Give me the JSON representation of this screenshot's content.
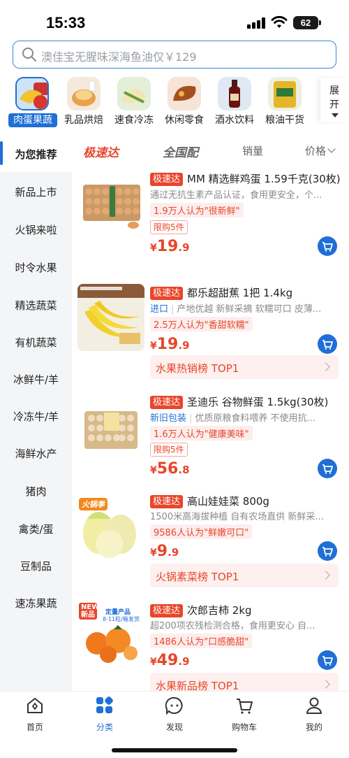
{
  "status": {
    "time": "15:33",
    "battery": "62"
  },
  "search": {
    "placeholder": "澳佳宝无腥味深海鱼油仅￥129"
  },
  "categories": [
    {
      "label": "肉蛋果蔬",
      "icon": "produce-meat-icon",
      "active": true
    },
    {
      "label": "乳品烘焙",
      "icon": "dairy-bakery-icon"
    },
    {
      "label": "速食冷冻",
      "icon": "frozen-food-icon"
    },
    {
      "label": "休闲零食",
      "icon": "snacks-icon"
    },
    {
      "label": "酒水饮料",
      "icon": "drinks-icon"
    },
    {
      "label": "粮油干货",
      "icon": "grain-oil-icon"
    }
  ],
  "expand_label": "展开",
  "sidebar": [
    "为您推荐",
    "新品上市",
    "火锅来啦",
    "时令水果",
    "精选蔬菜",
    "有机蔬菜",
    "冰鲜牛/羊",
    "冷冻牛/羊",
    "海鲜水产",
    "猪肉",
    "禽类/蛋",
    "豆制品",
    "速冻果蔬"
  ],
  "sort": {
    "speed": "极速达",
    "nation": "全国配",
    "sales": "销量",
    "price": "价格"
  },
  "products": [
    {
      "tag": "极速达",
      "title": "MM 精选鲜鸡蛋 1.59千克(30枚)",
      "desc": "通过无抗生素产品认证，食用更安全，个...",
      "praise": "1.9万人认为\"很新鲜\"",
      "limit": "限购5件",
      "price_yuan": "¥",
      "price_int": "19",
      "price_dec": ".9"
    },
    {
      "tag": "极速达",
      "title": "都乐超甜蕉 1把 1.4kg",
      "desc_tag": "进口",
      "desc": "产地优越 新鲜采摘 软糯可口 皮薄...",
      "praise": "2.5万人认为\"香甜软糯\"",
      "price_yuan": "¥",
      "price_int": "19",
      "price_dec": ".9",
      "rank": "水果热销榜 TOP1"
    },
    {
      "tag": "极速达",
      "title": "圣迪乐 谷物鲜蛋 1.5kg(30枚)",
      "desc_tag": "新旧包装",
      "desc": "优质原粮食料喂养 不使用抗...",
      "praise": "1.6万人认为\"健康美味\"",
      "limit": "限购5件",
      "price_yuan": "¥",
      "price_int": "56",
      "price_dec": ".8"
    },
    {
      "tag": "极速达",
      "title": "高山娃娃菜 800g",
      "desc": "1500米高海拔种植 自有农场直供 新鲜采...",
      "praise": "9586人认为\"鲜嫩可口\"",
      "price_yuan": "¥",
      "price_int": "9",
      "price_dec": ".9",
      "rank": "火锅素菜榜 TOP1",
      "badge": "火锅季"
    },
    {
      "tag": "极速达",
      "title": "次郎吉柿 2kg",
      "desc": "超200项农残检测合格，食用更安心 自...",
      "praise": "1486人认为\"口感脆甜\"",
      "price_yuan": "¥",
      "price_int": "49",
      "price_dec": ".9",
      "rank": "水果新品榜 TOP1",
      "badge": "NEW新品",
      "img_text_1": "定量产品",
      "img_text_2": "8-11粒/箱发货"
    }
  ],
  "tabs": [
    {
      "label": "首页",
      "icon": "home-icon"
    },
    {
      "label": "分类",
      "icon": "category-icon",
      "active": true
    },
    {
      "label": "发现",
      "icon": "discover-icon"
    },
    {
      "label": "购物车",
      "icon": "cart-icon"
    },
    {
      "label": "我的",
      "icon": "profile-icon"
    }
  ],
  "colors": {
    "accent": "#1f6fd6",
    "price": "#e8462a",
    "sidebar_bg": "#f4f5f7"
  }
}
